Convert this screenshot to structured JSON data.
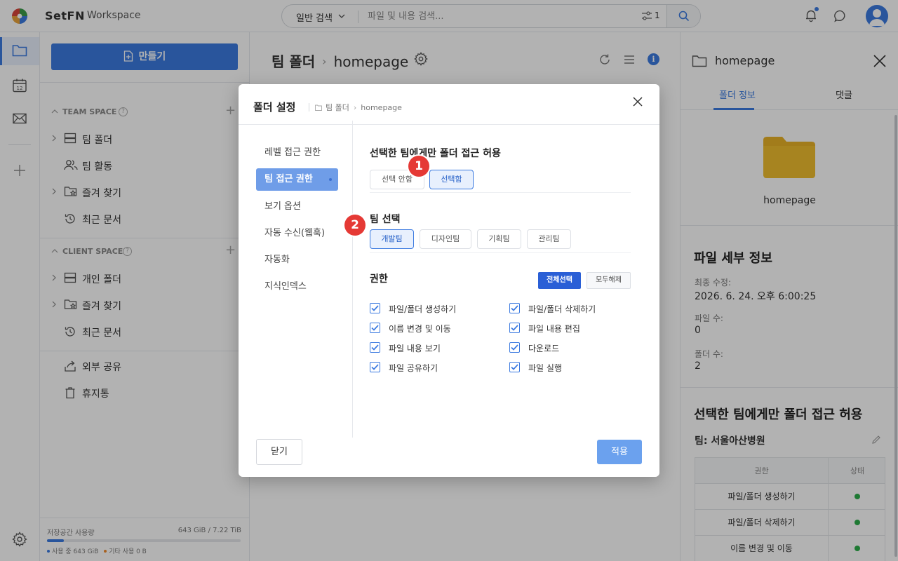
{
  "topbar": {
    "brand": "SetFN",
    "workspace": "Workspace",
    "search_mode": "일반 검색",
    "search_placeholder": "파일 및 내용 검색...",
    "filter_count": "1"
  },
  "sidebar": {
    "create_label": "만들기",
    "team_space": {
      "title": "TEAM SPACE",
      "items": [
        "팀 폴더",
        "팀 활동",
        "즐겨 찾기",
        "최근 문서"
      ]
    },
    "client_space": {
      "title": "CLIENT SPACE",
      "items": [
        "개인 폴더",
        "즐겨 찾기",
        "최근 문서"
      ]
    },
    "extra_items": [
      "외부 공유",
      "휴지통"
    ],
    "storage": {
      "label": "저장공간 사용량",
      "value": "643 GiB / 7.22 TiB",
      "used_fraction": 0.087,
      "legend_used": "사용 중 643 GiB",
      "legend_other": "기타 사용 0 B"
    }
  },
  "main": {
    "breadcrumb_root": "팀 폴더",
    "breadcrumb_current": "homepage",
    "info_glyph": "i"
  },
  "right_panel": {
    "title": "homepage",
    "tabs": [
      "폴더 정보",
      "댓글"
    ],
    "folder_name": "homepage",
    "details_heading": "파일 세부 정보",
    "modified_label": "최종 수정:",
    "modified_value": "2026. 6. 24. 오후 6:00:25",
    "files_label": "파일 수:",
    "files_value": "0",
    "folders_label": "폴더 수:",
    "folders_value": "2",
    "access_heading": "선택한 팀에게만 폴더 접근 허용",
    "team_label": "팀: 서울아산병원",
    "table_headers": [
      "권한",
      "상태"
    ],
    "table_rows": [
      "파일/폴더 생성하기",
      "파일/폴더 삭제하기",
      "이름 변경 및 이동"
    ]
  },
  "modal": {
    "title": "폴더 설정",
    "crumb_root": "팀 폴더",
    "crumb_current": "homepage",
    "nav": [
      "레벨 접근 권한",
      "팀 접근 권한",
      "보기 옵션",
      "자동 수신(웹훅)",
      "자동화",
      "지식인덱스"
    ],
    "access_heading": "선택한 팀에게만 폴더 접근 허용",
    "access_options": [
      "선택 안함",
      "선택함"
    ],
    "team_heading": "팀 선택",
    "teams": [
      "개발팀",
      "디자인팀",
      "기획팀",
      "관리팀"
    ],
    "perm_heading": "권한",
    "select_all": "전체선택",
    "deselect_all": "모두해제",
    "permissions": [
      "파일/폴더 생성하기",
      "파일/폴더 삭제하기",
      "이름 변경 및 이동",
      "파일 내용 편집",
      "파일 내용 보기",
      "다운로드",
      "파일 공유하기",
      "파일 실행"
    ],
    "close_label": "닫기",
    "apply_label": "적용"
  },
  "badges": [
    "1",
    "2"
  ],
  "colors": {
    "accent": "#3b7ae0",
    "danger_badge": "#e53935",
    "status_ok": "#2cae4a",
    "folder_yellow": "#e8b227"
  }
}
